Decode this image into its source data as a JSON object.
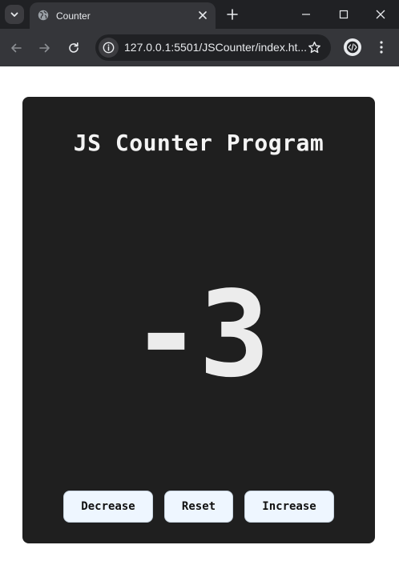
{
  "browser": {
    "tab_title": "Counter",
    "url": "127.0.0.1:5501/JSCounter/index.ht..."
  },
  "page": {
    "heading": "JS Counter Program",
    "count": "-3",
    "buttons": {
      "decrease": "Decrease",
      "reset": "Reset",
      "increase": "Increase"
    }
  },
  "icons": {
    "tab_search": "chevron-down-icon",
    "favicon": "globe-icon",
    "tab_close": "close-icon",
    "new_tab": "plus-icon",
    "minimize": "minimize-icon",
    "maximize": "maximize-icon",
    "close": "close-icon",
    "back": "arrow-left-icon",
    "forward": "arrow-right-icon",
    "reload": "reload-icon",
    "site_info": "info-icon",
    "bookmark": "star-icon",
    "extension": "code-icon",
    "menu": "more-vertical-icon"
  },
  "colors": {
    "card_bg": "#1f1f1f",
    "button_bg": "#eef6ff",
    "text_light": "#ececec"
  }
}
